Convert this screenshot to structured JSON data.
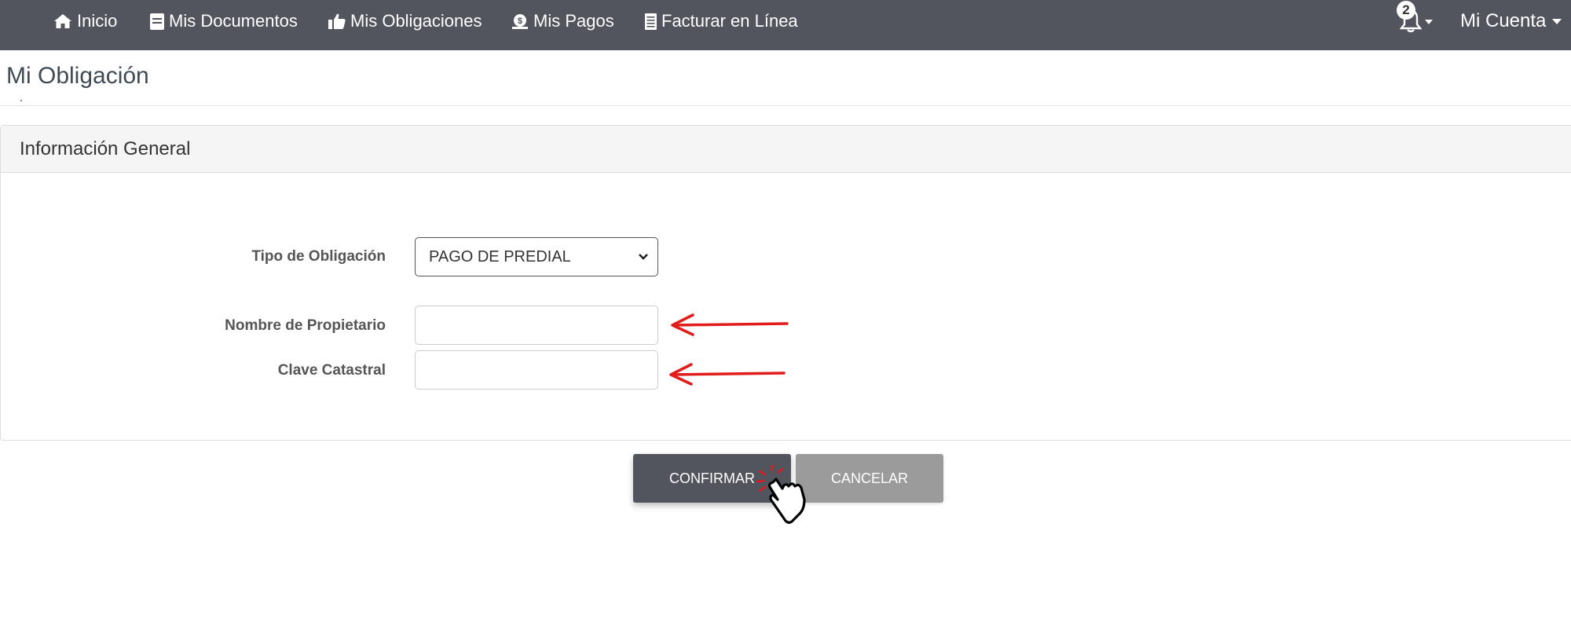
{
  "navbar": {
    "items": [
      {
        "label": "Inicio",
        "icon": "home-icon"
      },
      {
        "label": "Mis Documentos",
        "icon": "document-icon"
      },
      {
        "label": "Mis Obligaciones",
        "icon": "thumbs-up-icon"
      },
      {
        "label": "Mis Pagos",
        "icon": "payment-icon"
      },
      {
        "label": "Facturar en Línea",
        "icon": "invoice-icon"
      }
    ],
    "notifications_count": "2",
    "account_label": "Mi Cuenta",
    "background_color": "#53555e"
  },
  "page": {
    "title": "Mi Obligación"
  },
  "panel": {
    "heading": "Información General",
    "fields": {
      "tipo_label": "Tipo de Obligación",
      "tipo_value": "PAGO DE PREDIAL",
      "propietario_label": "Nombre de Propietario",
      "propietario_value": "",
      "clave_label": "Clave Catastral",
      "clave_value": ""
    }
  },
  "buttons": {
    "confirm_label": "CONFIRMAR",
    "cancel_label": "CANCELAR"
  },
  "annotations": {
    "arrow_color": "#e21b1b",
    "cursor": "hand-pointer-icon"
  }
}
